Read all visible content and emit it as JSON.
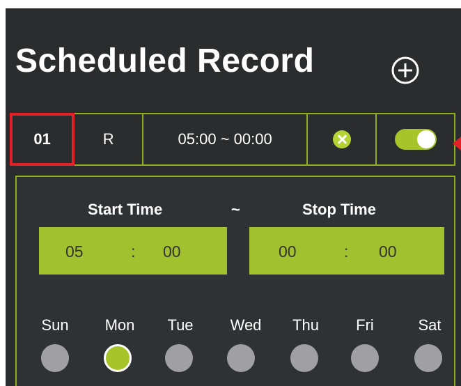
{
  "header": {
    "title": "Scheduled Record",
    "add_icon": "plus-circle-icon"
  },
  "schedule_row": {
    "index": "01",
    "type": "R",
    "time_range": "05:00 ~ 00:00",
    "delete_icon": "x-circle-icon",
    "enabled": true
  },
  "editor": {
    "start_label": "Start Time",
    "separator": "~",
    "stop_label": "Stop Time",
    "start": {
      "hour": "05",
      "sep": ":",
      "minute": "00"
    },
    "stop": {
      "hour": "00",
      "sep": ":",
      "minute": "00"
    },
    "days": [
      {
        "label": "Sun",
        "selected": false
      },
      {
        "label": "Mon",
        "selected": true
      },
      {
        "label": "Tue",
        "selected": false
      },
      {
        "label": "Wed",
        "selected": false
      },
      {
        "label": "Thu",
        "selected": false
      },
      {
        "label": "Fri",
        "selected": false
      },
      {
        "label": "Sat",
        "selected": false
      }
    ]
  },
  "colors": {
    "accent": "#a2c12e",
    "highlight": "#e12126",
    "background": "#2a2c2e"
  }
}
